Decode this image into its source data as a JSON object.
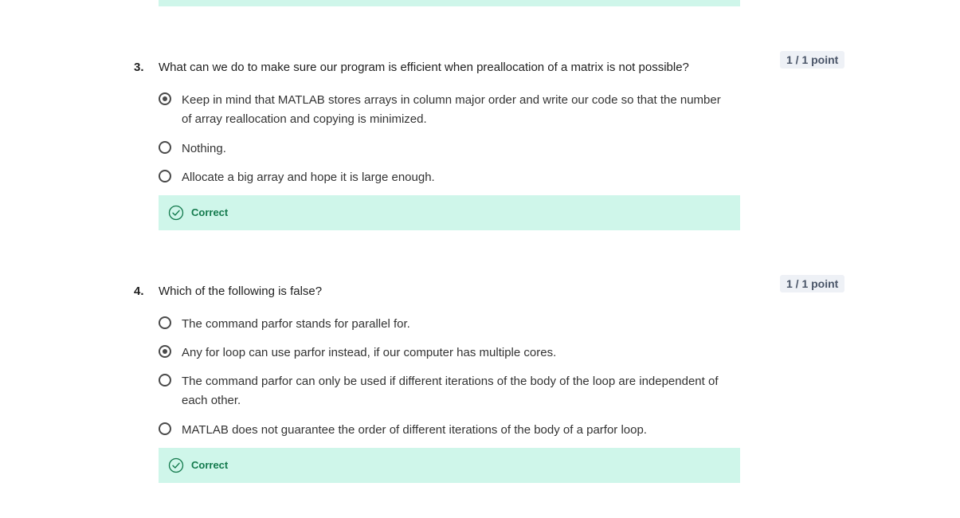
{
  "questions": [
    {
      "number": "3.",
      "text": "What can we do to make sure our program is efficient when preallocation of a matrix is not possible?",
      "points": "1 / 1 point",
      "options": [
        {
          "label": "Keep in mind that MATLAB stores arrays in column major order and write our code so that the number of array reallocation and copying is minimized.",
          "selected": true
        },
        {
          "label": "Nothing.",
          "selected": false
        },
        {
          "label": "Allocate a big array and hope it is large enough.",
          "selected": false
        }
      ],
      "feedback": "Correct"
    },
    {
      "number": "4.",
      "text": "Which of the following is false?",
      "points": "1 / 1 point",
      "options": [
        {
          "label": "The command parfor stands for parallel for.",
          "selected": false
        },
        {
          "label": "Any for loop can use parfor instead, if our computer has multiple cores.",
          "selected": true
        },
        {
          "label": "The command parfor can only be used if different iterations of the body of the loop are independent of each other.",
          "selected": false
        },
        {
          "label": "MATLAB does not guarantee the order of different iterations of the body of a parfor loop.",
          "selected": false
        }
      ],
      "feedback": "Correct"
    }
  ],
  "colors": {
    "feedback_bg": "#cff6ea",
    "feedback_text": "#137a4d",
    "points_bg": "#eef1f6"
  },
  "icons": {
    "feedback": "check-circle-icon",
    "option": "radio-icon"
  }
}
